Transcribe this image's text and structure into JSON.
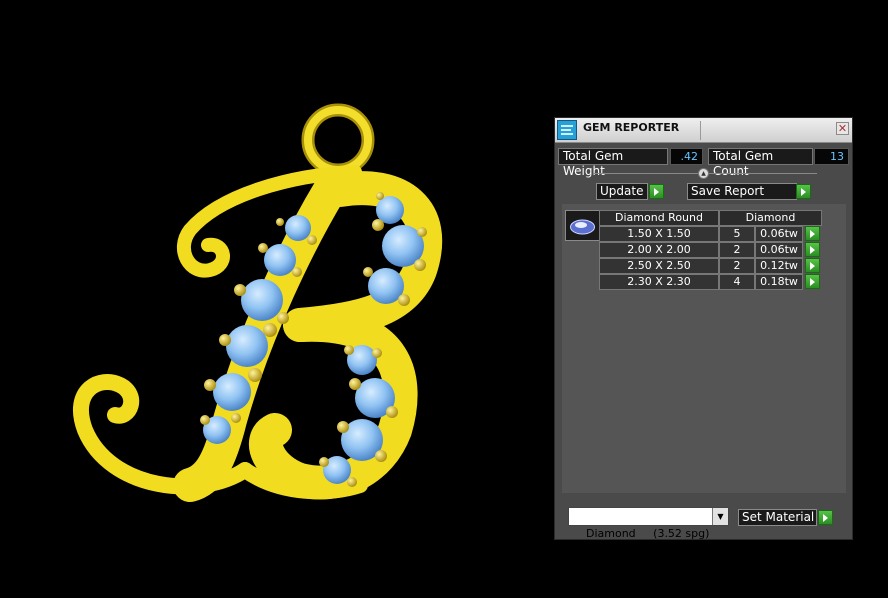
{
  "panel": {
    "title": "GEM REPORTER",
    "close_glyph": "✕",
    "app_icon": "gem-reporter-icon"
  },
  "totals": {
    "weight_label": "Total Gem Weight",
    "weight_value": ".42",
    "count_label": "Total Gem Count",
    "count_value": "13"
  },
  "actions": {
    "update_label": "Update",
    "save_report_label": "Save Report"
  },
  "report": {
    "shape_header": "Diamond Round",
    "material_header": "Diamond",
    "rows": [
      {
        "size": "1.50 X 1.50",
        "count": "5",
        "weight": "0.06tw"
      },
      {
        "size": "2.00 X 2.00",
        "count": "2",
        "weight": "0.06tw"
      },
      {
        "size": "2.50 X 2.50",
        "count": "2",
        "weight": "0.12tw"
      },
      {
        "size": "2.30 X 2.30",
        "count": "4",
        "weight": "0.18tw"
      }
    ]
  },
  "material": {
    "selected": "Diamond     (3.52 spg)",
    "set_label": "Set Material"
  },
  "colors": {
    "gold": "#f2dc1f",
    "gem": "#7db4ee",
    "panel_bg": "#4a4a4a",
    "value_text": "#66c4ff",
    "go_button": "#3aa42f"
  }
}
